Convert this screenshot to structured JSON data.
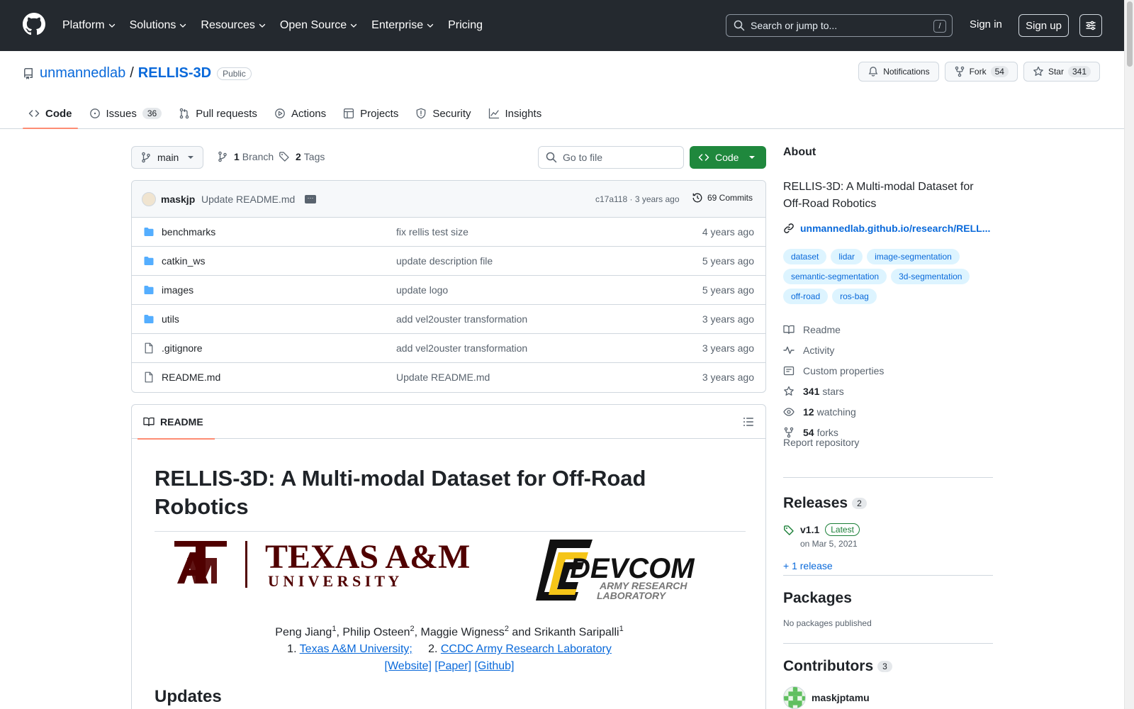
{
  "header": {
    "nav": [
      {
        "label": "Platform",
        "caret": true
      },
      {
        "label": "Solutions",
        "caret": true
      },
      {
        "label": "Resources",
        "caret": true
      },
      {
        "label": "Open Source",
        "caret": true
      },
      {
        "label": "Enterprise",
        "caret": true
      },
      {
        "label": "Pricing",
        "caret": false
      }
    ],
    "search_placeholder": "Search or jump to...",
    "search_shortcut": "/",
    "signin": "Sign in",
    "signup": "Sign up"
  },
  "repo": {
    "owner": "unmannedlab",
    "separator": "/",
    "name": "RELLIS-3D",
    "visibility": "Public",
    "notifications": "Notifications",
    "fork_label": "Fork",
    "fork_count": "54",
    "star_label": "Star",
    "star_count": "341"
  },
  "tabs": [
    {
      "label": "Code",
      "icon": "code-icon",
      "count": ""
    },
    {
      "label": "Issues",
      "icon": "issue-icon",
      "count": "36"
    },
    {
      "label": "Pull requests",
      "icon": "pull-request-icon",
      "count": ""
    },
    {
      "label": "Actions",
      "icon": "play-icon",
      "count": ""
    },
    {
      "label": "Projects",
      "icon": "table-icon",
      "count": ""
    },
    {
      "label": "Security",
      "icon": "shield-icon",
      "count": ""
    },
    {
      "label": "Insights",
      "icon": "graph-icon",
      "count": ""
    }
  ],
  "toolbar": {
    "branch": "main",
    "branch_count": "1",
    "branch_label": "Branch",
    "tag_count": "2",
    "tag_label": "Tags",
    "goto_placeholder": "Go to file",
    "code_label": "Code"
  },
  "commit": {
    "author": "maskjp",
    "message": "Update README.md",
    "hash_time": "c17a118 · 3 years ago",
    "commits": "69 Commits"
  },
  "files": [
    {
      "type": "folder",
      "name": "benchmarks",
      "message": "fix rellis test size",
      "date": "4 years ago"
    },
    {
      "type": "folder",
      "name": "catkin_ws",
      "message": "update description file",
      "date": "5 years ago"
    },
    {
      "type": "folder",
      "name": "images",
      "message": "update logo",
      "date": "5 years ago"
    },
    {
      "type": "folder",
      "name": "utils",
      "message": "add vel2ouster transformation",
      "date": "3 years ago"
    },
    {
      "type": "file",
      "name": ".gitignore",
      "message": "add vel2ouster transformation",
      "date": "3 years ago"
    },
    {
      "type": "file",
      "name": "README.md",
      "message": "Update README.md",
      "date": "3 years ago"
    }
  ],
  "readme": {
    "tab": "README",
    "title": "RELLIS-3D: A Multi-modal Dataset for Off-Road Robotics",
    "tamu_main": "TEXAS A&M",
    "tamu_sub": "U N I V E R S I T Y",
    "devcom_main": "DEVCOM",
    "devcom_sub1": "ARMY RESEARCH",
    "devcom_sub2": "LABORATORY",
    "authors": [
      {
        "name": "Peng Jiang",
        "sup": "1",
        "after": ", "
      },
      {
        "name": "Philip Osteen",
        "sup": "2",
        "after": ", "
      },
      {
        "name": "Maggie Wigness",
        "sup": "2",
        "after": " and "
      },
      {
        "name": "Srikanth Saripalli",
        "sup": "1",
        "after": ""
      }
    ],
    "aff1_num": "1.",
    "aff1": "Texas A&M University;",
    "aff2_num": "2.",
    "aff2": "CCDC Army Research Laboratory",
    "links": [
      "[Website]",
      "[Paper]",
      "[Github]"
    ],
    "updates": "Updates"
  },
  "sidebar": {
    "about": "About",
    "description": "RELLIS-3D: A Multi-modal Dataset for Off-Road Robotics",
    "website": "unmannedlab.github.io/research/RELL...",
    "topics": [
      "dataset",
      "lidar",
      "image-segmentation",
      "semantic-segmentation",
      "3d-segmentation",
      "off-road",
      "ros-bag"
    ],
    "stats": [
      {
        "icon": "book-icon",
        "bold": "",
        "label": "Readme"
      },
      {
        "icon": "pulse-icon",
        "bold": "",
        "label": "Activity"
      },
      {
        "icon": "note-icon",
        "bold": "",
        "label": "Custom properties"
      },
      {
        "icon": "star-icon",
        "bold": "341",
        "label": "stars"
      },
      {
        "icon": "eye-icon",
        "bold": "12",
        "label": "watching"
      },
      {
        "icon": "fork-icon",
        "bold": "54",
        "label": "forks"
      }
    ],
    "report": "Report repository",
    "releases_title": "Releases",
    "releases_count": "2",
    "release_name": "v1.1",
    "release_badge": "Latest",
    "release_date": "on Mar 5, 2021",
    "more_releases": "+ 1 release",
    "packages_title": "Packages",
    "packages_empty": "No packages published",
    "contributors_title": "Contributors",
    "contributors_count": "3",
    "contributor": "maskjptamu"
  },
  "colors": {
    "header_bg": "#24292f",
    "link": "#0969da",
    "primary_button": "#1f883d",
    "tab_underline": "#fd8c73",
    "tamu_maroon": "#500000",
    "devcom_yellow": "#f5c518"
  }
}
